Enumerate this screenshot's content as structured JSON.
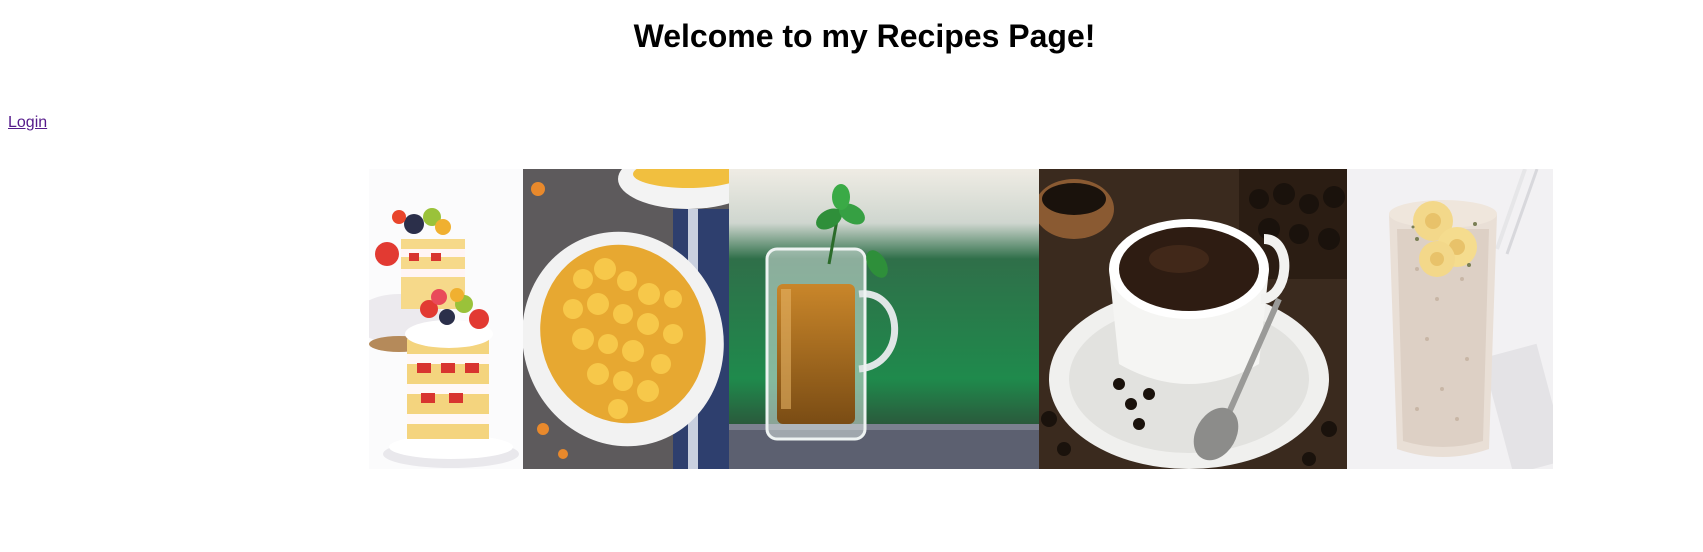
{
  "header": {
    "title": "Welcome to my Recipes Page!"
  },
  "nav": {
    "login_label": "Login"
  },
  "gallery": {
    "images": [
      {
        "name": "cake-image",
        "alt": "Layered strawberry fruit cake"
      },
      {
        "name": "mac-and-cheese-image",
        "alt": "Macaroni and cheese in a white dish"
      },
      {
        "name": "tea-image",
        "alt": "Glass mug of tea with mint"
      },
      {
        "name": "coffee-image",
        "alt": "Cup of black coffee with spoon"
      },
      {
        "name": "smoothie-image",
        "alt": "Banana smoothie in a tall glass"
      }
    ]
  },
  "colors": {
    "link": "#551a8b",
    "text": "#000000",
    "background": "#ffffff"
  }
}
